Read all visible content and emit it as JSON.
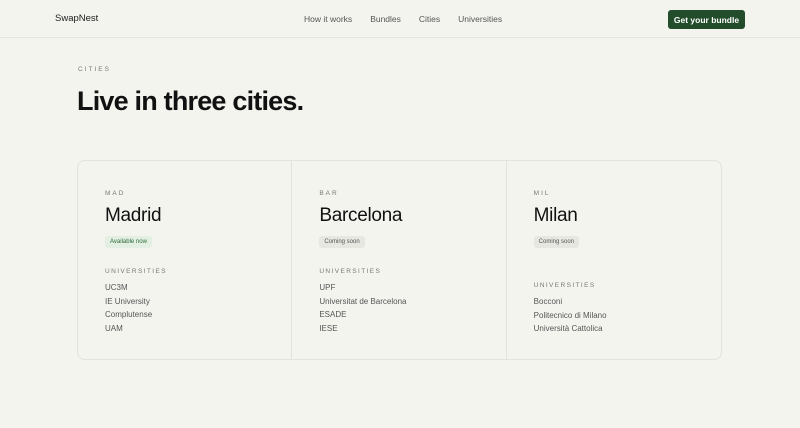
{
  "header": {
    "logo": "SwapNest",
    "nav": [
      "How it works",
      "Bundles",
      "Cities",
      "Universities"
    ],
    "cta_label": "Get your bundle"
  },
  "section": {
    "eyebrow": "CITIES",
    "title": "Live in three cities."
  },
  "cities": [
    {
      "code": "MAD",
      "name": "Madrid",
      "status": "Available now",
      "universities_label": "UNIVERSITIES",
      "universities": [
        "UC3M",
        "IE University",
        "Complutense",
        "UAM"
      ]
    },
    {
      "code": "BAR",
      "name": "Barcelona",
      "status": "Coming soon",
      "universities_label": "UNIVERSITIES",
      "universities": [
        "UPF",
        "Universitat de Barcelona",
        "ESADE",
        "IESE"
      ]
    },
    {
      "code": "MIL",
      "name": "Milan",
      "status": "Coming soon",
      "universities_label": "UNIVERSITIES",
      "universities": [
        "Bocconi",
        "Politecnico di Milano",
        "Università Cattolica"
      ]
    }
  ],
  "colors": {
    "background": "#f4f4ef",
    "cta": "#234c2b",
    "available_bg": "#e3efe2",
    "available_text": "#2d6a3a"
  }
}
